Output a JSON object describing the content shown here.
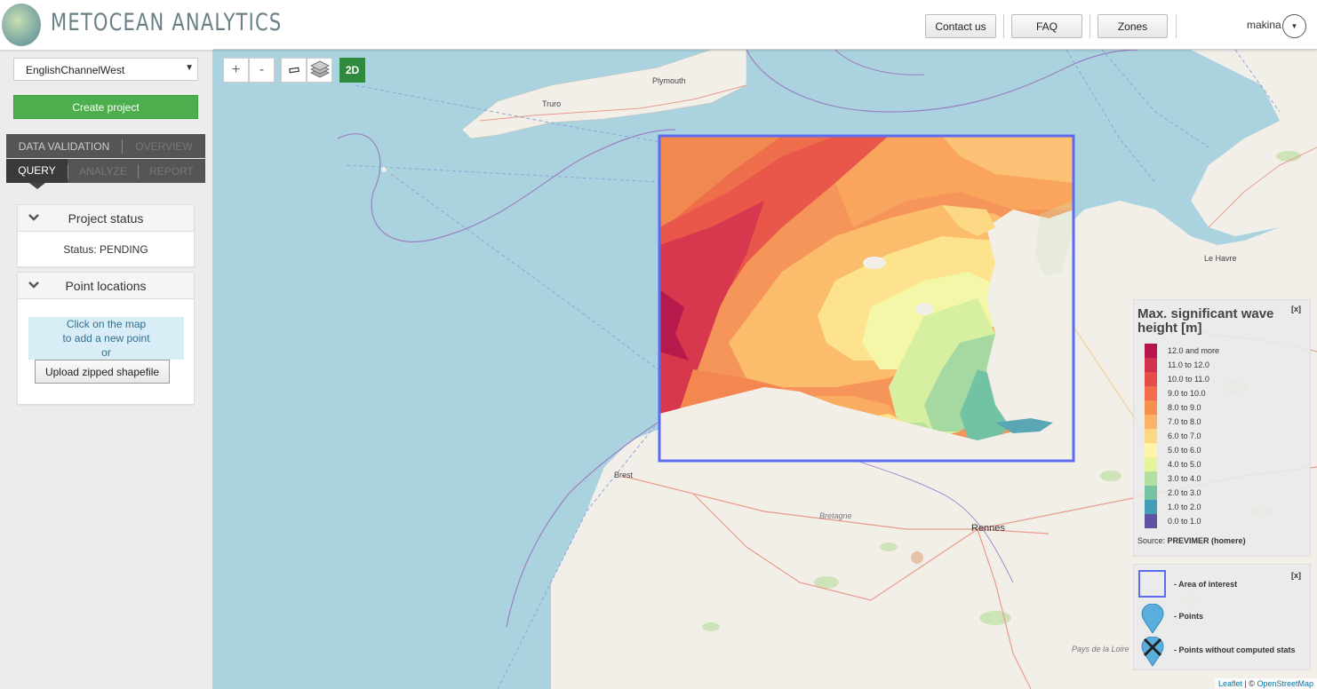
{
  "header": {
    "logo_text": "METOCEAN ANALYTICS",
    "nav": {
      "contact": "Contact us",
      "faq": "FAQ",
      "zones": "Zones"
    },
    "user": "makina"
  },
  "sidebar": {
    "zone_select": "EnglishChannelWest",
    "create_project": "Create project",
    "tabs_row1": [
      "DATA VALIDATION",
      "OVERVIEW"
    ],
    "tabs_row2": [
      "QUERY",
      "ANALYZE",
      "REPORT"
    ],
    "project_status": {
      "title": "Project status",
      "status": "Status: PENDING"
    },
    "point_locations": {
      "title": "Point locations",
      "hint_line1": "Click on the map",
      "hint_line2": "to add a new point",
      "hint_line3": "or",
      "upload": "Upload zipped shapefile"
    }
  },
  "map": {
    "controls": {
      "zoom_in": "+",
      "zoom_out": "-",
      "mode_2d": "2D"
    },
    "places": {
      "plymouth": "Plymouth",
      "truro": "Truro",
      "le_havre": "Le Havre",
      "brest": "Brest",
      "bretagne": "Bretagne",
      "rennes": "Rennes",
      "pays_de_la_loire": "Pays de la Loire"
    },
    "legend": {
      "close": "[x]",
      "title": "Max. significant wave height [m]",
      "items": [
        {
          "label": "12.0 and more",
          "color": "#b5174b"
        },
        {
          "label": "11.0 to 12.0",
          "color": "#d2304c"
        },
        {
          "label": "10.0 to 11.0",
          "color": "#e34d4a"
        },
        {
          "label": "9.0 to 10.0",
          "color": "#f26d4a"
        },
        {
          "label": "8.0 to 9.0",
          "color": "#f7904f"
        },
        {
          "label": "7.0 to 8.0",
          "color": "#fbb467"
        },
        {
          "label": "6.0 to 7.0",
          "color": "#fcd884"
        },
        {
          "label": "5.0 to 6.0",
          "color": "#fef5a8"
        },
        {
          "label": "4.0 to 5.0",
          "color": "#e6f59c"
        },
        {
          "label": "3.0 to 4.0",
          "color": "#b2df9f"
        },
        {
          "label": "2.0 to 3.0",
          "color": "#76c4a3"
        },
        {
          "label": "1.0 to 2.0",
          "color": "#449cb6"
        },
        {
          "label": "0.0 to 1.0",
          "color": "#5e52a3"
        }
      ],
      "source_label": "Source:",
      "source_value": "PREVIMER (homere)"
    },
    "legend2": {
      "close": "[x]",
      "area": "- Area of interest",
      "points": "- Points",
      "points_nostats": "- Points without computed stats"
    },
    "attribution": {
      "leaflet": "Leaflet",
      "sep": " | © ",
      "osm": "OpenStreetMap"
    },
    "colors": {
      "sea": "#aad3df",
      "land": "#f2efe9",
      "area_border": "#5b6cf0"
    }
  }
}
